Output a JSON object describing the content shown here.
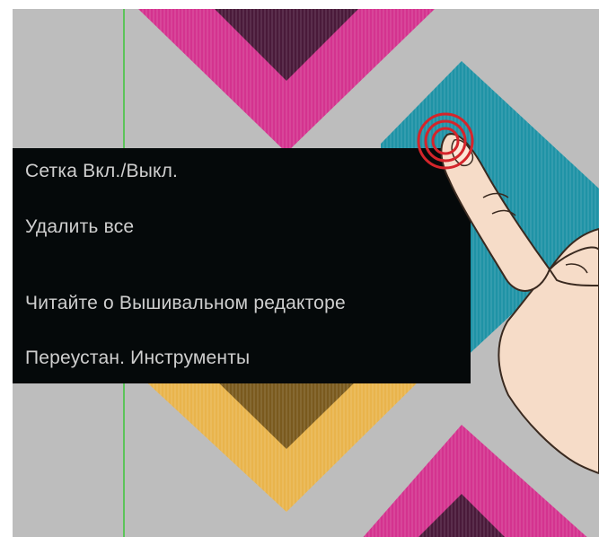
{
  "colors": {
    "canvas_bg": "#bdbdbd",
    "grid_line": "#5cc45a",
    "magenta": "#d4338f",
    "magenta_dark": "#4a1a3a",
    "teal": "#1f93a6",
    "yellow": "#e9b44c",
    "yellow_dark": "#7a5a1e",
    "menu_bg": "#05090a",
    "menu_text": "#cfcfcf",
    "touch_ring": "#d4252b"
  },
  "context_menu": {
    "items": [
      {
        "label": "Сетка Вкл./Выкл."
      },
      {
        "label": "Удалить все"
      },
      {
        "label": "Читайте о Вышивальном редакторе"
      },
      {
        "label": "Переустан.  Инструменты"
      }
    ]
  },
  "icons": {
    "touch_indicator": "touch-press-icon",
    "hand": "pointing-hand-icon"
  }
}
